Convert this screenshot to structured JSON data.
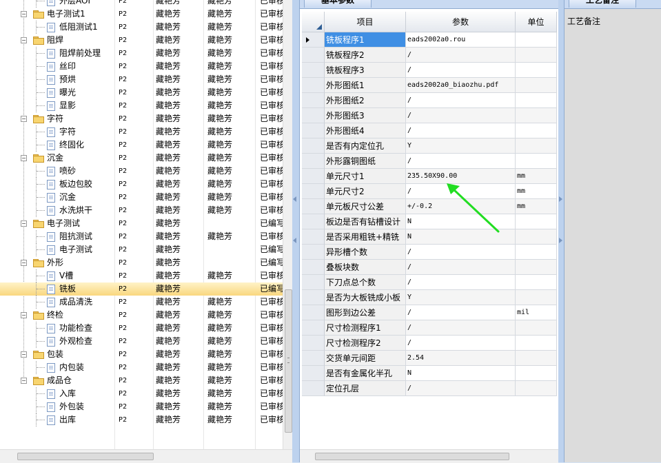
{
  "tree": {
    "rows": [
      {
        "name": "外层AOI",
        "level": 1,
        "type": "doc",
        "p": "P2",
        "a": "藏艳芳",
        "b": "藏艳芳",
        "c": "已审核"
      },
      {
        "name": "电子测试1",
        "level": 0,
        "type": "folder",
        "p": "P2",
        "a": "藏艳芳",
        "b": "藏艳芳",
        "c": "已审核"
      },
      {
        "name": "低阻测试1",
        "level": 1,
        "type": "doc",
        "p": "P2",
        "a": "藏艳芳",
        "b": "藏艳芳",
        "c": "已审核"
      },
      {
        "name": "阻焊",
        "level": 0,
        "type": "folder",
        "p": "P2",
        "a": "藏艳芳",
        "b": "藏艳芳",
        "c": "已审核"
      },
      {
        "name": "阻焊前处理",
        "level": 1,
        "type": "doc",
        "p": "P2",
        "a": "藏艳芳",
        "b": "藏艳芳",
        "c": "已审核"
      },
      {
        "name": "丝印",
        "level": 1,
        "type": "doc",
        "p": "P2",
        "a": "藏艳芳",
        "b": "藏艳芳",
        "c": "已审核"
      },
      {
        "name": "预烘",
        "level": 1,
        "type": "doc",
        "p": "P2",
        "a": "藏艳芳",
        "b": "藏艳芳",
        "c": "已审核"
      },
      {
        "name": "曝光",
        "level": 1,
        "type": "doc",
        "p": "P2",
        "a": "藏艳芳",
        "b": "藏艳芳",
        "c": "已审核"
      },
      {
        "name": "显影",
        "level": 1,
        "type": "doc",
        "p": "P2",
        "a": "藏艳芳",
        "b": "藏艳芳",
        "c": "已审核"
      },
      {
        "name": "字符",
        "level": 0,
        "type": "folder",
        "p": "P2",
        "a": "藏艳芳",
        "b": "藏艳芳",
        "c": "已审核"
      },
      {
        "name": "字符",
        "level": 1,
        "type": "doc",
        "p": "P2",
        "a": "藏艳芳",
        "b": "藏艳芳",
        "c": "已审核"
      },
      {
        "name": "终固化",
        "level": 1,
        "type": "doc",
        "p": "P2",
        "a": "藏艳芳",
        "b": "藏艳芳",
        "c": "已审核"
      },
      {
        "name": "沉金",
        "level": 0,
        "type": "folder",
        "p": "P2",
        "a": "藏艳芳",
        "b": "藏艳芳",
        "c": "已审核"
      },
      {
        "name": "喷砂",
        "level": 1,
        "type": "doc",
        "p": "P2",
        "a": "藏艳芳",
        "b": "藏艳芳",
        "c": "已审核"
      },
      {
        "name": "板边包胶",
        "level": 1,
        "type": "doc",
        "p": "P2",
        "a": "藏艳芳",
        "b": "藏艳芳",
        "c": "已审核"
      },
      {
        "name": "沉金",
        "level": 1,
        "type": "doc",
        "p": "P2",
        "a": "藏艳芳",
        "b": "藏艳芳",
        "c": "已审核"
      },
      {
        "name": "水洗烘干",
        "level": 1,
        "type": "doc",
        "p": "P2",
        "a": "藏艳芳",
        "b": "藏艳芳",
        "c": "已审核"
      },
      {
        "name": "电子测试",
        "level": 0,
        "type": "folder",
        "p": "P2",
        "a": "藏艳芳",
        "b": "",
        "c": "已编写"
      },
      {
        "name": "阻抗测试",
        "level": 1,
        "type": "doc",
        "p": "P2",
        "a": "藏艳芳",
        "b": "藏艳芳",
        "c": "已审核"
      },
      {
        "name": "电子测试",
        "level": 1,
        "type": "doc",
        "p": "P2",
        "a": "藏艳芳",
        "b": "",
        "c": "已编写"
      },
      {
        "name": "外形",
        "level": 0,
        "type": "folder",
        "p": "P2",
        "a": "藏艳芳",
        "b": "",
        "c": "已编写"
      },
      {
        "name": "V槽",
        "level": 1,
        "type": "doc",
        "p": "P2",
        "a": "藏艳芳",
        "b": "藏艳芳",
        "c": "已审核"
      },
      {
        "name": "铣板",
        "level": 1,
        "type": "doc",
        "p": "P2",
        "a": "藏艳芳",
        "b": "",
        "c": "已编写",
        "selected": true
      },
      {
        "name": "成品清洗",
        "level": 1,
        "type": "doc",
        "p": "P2",
        "a": "藏艳芳",
        "b": "藏艳芳",
        "c": "已审核"
      },
      {
        "name": "终检",
        "level": 0,
        "type": "folder",
        "p": "P2",
        "a": "藏艳芳",
        "b": "藏艳芳",
        "c": "已审核"
      },
      {
        "name": "功能检查",
        "level": 1,
        "type": "doc",
        "p": "P2",
        "a": "藏艳芳",
        "b": "藏艳芳",
        "c": "已审核"
      },
      {
        "name": "外观检查",
        "level": 1,
        "type": "doc",
        "p": "P2",
        "a": "藏艳芳",
        "b": "藏艳芳",
        "c": "已审核"
      },
      {
        "name": "包装",
        "level": 0,
        "type": "folder",
        "p": "P2",
        "a": "藏艳芳",
        "b": "藏艳芳",
        "c": "已审核"
      },
      {
        "name": "内包装",
        "level": 1,
        "type": "doc",
        "p": "P2",
        "a": "藏艳芳",
        "b": "藏艳芳",
        "c": "已审核"
      },
      {
        "name": "成品仓",
        "level": 0,
        "type": "folder",
        "p": "P2",
        "a": "藏艳芳",
        "b": "藏艳芳",
        "c": "已审核"
      },
      {
        "name": "入库",
        "level": 1,
        "type": "doc",
        "p": "P2",
        "a": "藏艳芳",
        "b": "藏艳芳",
        "c": "已审核"
      },
      {
        "name": "外包装",
        "level": 1,
        "type": "doc",
        "p": "P2",
        "a": "藏艳芳",
        "b": "藏艳芳",
        "c": "已审核"
      },
      {
        "name": "出库",
        "level": 1,
        "type": "doc",
        "p": "P2",
        "a": "藏艳芳",
        "b": "藏艳芳",
        "c": "已审核"
      }
    ]
  },
  "params_panel": {
    "tab_label": "基本参数",
    "headers": {
      "item": "项目",
      "param": "参数",
      "unit": "单位"
    },
    "rows": [
      {
        "item": "铣板程序1",
        "param": "eads2002a0.rou",
        "unit": ""
      },
      {
        "item": "铣板程序2",
        "param": "/",
        "unit": ""
      },
      {
        "item": "铣板程序3",
        "param": "/",
        "unit": ""
      },
      {
        "item": "外形图纸1",
        "param": "eads2002a0_biaozhu.pdf",
        "unit": ""
      },
      {
        "item": "外形图纸2",
        "param": "/",
        "unit": ""
      },
      {
        "item": "外形图纸3",
        "param": "/",
        "unit": ""
      },
      {
        "item": "外形图纸4",
        "param": "/",
        "unit": ""
      },
      {
        "item": "是否有内定位孔",
        "param": "Y",
        "unit": ""
      },
      {
        "item": "外形露铜图纸",
        "param": "/",
        "unit": ""
      },
      {
        "item": "单元尺寸1",
        "param": "235.50X90.00",
        "unit": "mm"
      },
      {
        "item": "单元尺寸2",
        "param": "/",
        "unit": "mm"
      },
      {
        "item": "单元板尺寸公差",
        "param": "+/-0.2",
        "unit": "mm"
      },
      {
        "item": "板边是否有钻槽设计",
        "param": "N",
        "unit": ""
      },
      {
        "item": "是否采用粗铣+精铣",
        "param": "N",
        "unit": ""
      },
      {
        "item": "异形槽个数",
        "param": "/",
        "unit": ""
      },
      {
        "item": "叠板块数",
        "param": "/",
        "unit": ""
      },
      {
        "item": "下刀点总个数",
        "param": "/",
        "unit": ""
      },
      {
        "item": "是否为大板铣成小板",
        "param": "Y",
        "unit": ""
      },
      {
        "item": "图形到边公差",
        "param": "/",
        "unit": "mil"
      },
      {
        "item": "尺寸检测程序1",
        "param": "/",
        "unit": ""
      },
      {
        "item": "尺寸检测程序2",
        "param": "/",
        "unit": ""
      },
      {
        "item": "交货单元间距",
        "param": "2.54",
        "unit": ""
      },
      {
        "item": "是否有金属化半孔",
        "param": "N",
        "unit": ""
      },
      {
        "item": "定位孔层",
        "param": "/",
        "unit": ""
      }
    ]
  },
  "notes_panel": {
    "tab_label": "工艺备注",
    "label": "工艺备注"
  },
  "colors": {
    "annotation_arrow": "#22dd22",
    "selected_row": "#f9d77e",
    "active_cell": "#3f8fe4"
  }
}
